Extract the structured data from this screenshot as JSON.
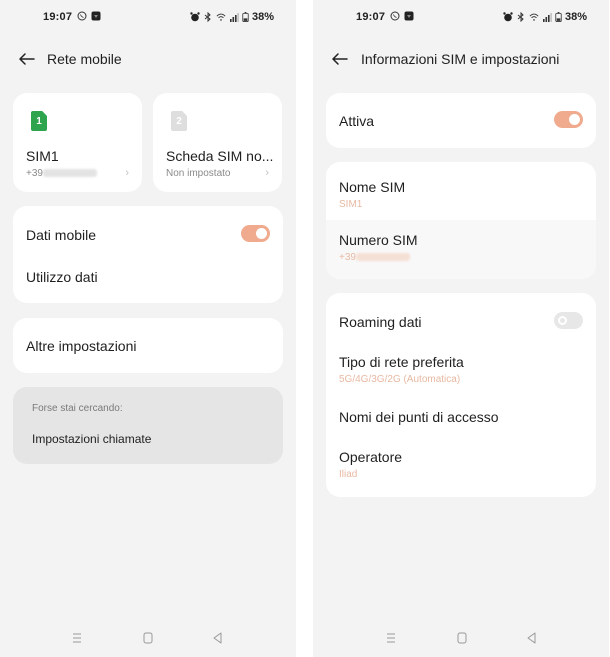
{
  "status_bar": {
    "time": "19:07",
    "left_icons": [
      "whatsapp-icon",
      "app-notification-icon"
    ],
    "right_icons": [
      "alarm-icon",
      "bluetooth-icon",
      "wifi-icon",
      "signal-icon",
      "battery-icon"
    ],
    "battery_percent": "38%"
  },
  "left_screen": {
    "title": "Rete mobile",
    "sim_cards": [
      {
        "slot": "1",
        "name": "SIM1",
        "subtitle_prefix": "+39",
        "subtitle_blurred": true,
        "icon_color": "#2ea44f"
      },
      {
        "slot": "2",
        "name": "Scheda SIM no...",
        "subtitle": "Non impostato",
        "icon_color": "#dedede"
      }
    ],
    "data_card": {
      "mobile_data_label": "Dati mobile",
      "mobile_data_on": true,
      "data_usage_label": "Utilizzo dati"
    },
    "other_settings_label": "Altre impostazioni",
    "suggestion": {
      "title": "Forse stai cercando:",
      "link": "Impostazioni chiamate"
    }
  },
  "right_screen": {
    "title": "Informazioni SIM e impostazioni",
    "active": {
      "label": "Attiva",
      "on": true
    },
    "sim_info": {
      "name_label": "Nome SIM",
      "name_value": "SIM1",
      "number_label": "Numero SIM",
      "number_prefix": "+39",
      "number_blurred": true
    },
    "network": {
      "roaming_label": "Roaming dati",
      "roaming_on": false,
      "network_type_label": "Tipo di rete preferita",
      "network_type_value": "5G/4G/3G/2G (Automatica)",
      "apn_label": "Nomi dei punti di accesso",
      "operator_label": "Operatore",
      "operator_value": "Iliad"
    }
  },
  "nav_bar": [
    "menu-button",
    "home-button",
    "back-button"
  ],
  "colors": {
    "accent": "#f0ab8f",
    "sub_text_accent": "#e8b9a2",
    "sim1_green": "#2ea44f",
    "background": "#f3f3f3",
    "card": "#ffffff"
  }
}
